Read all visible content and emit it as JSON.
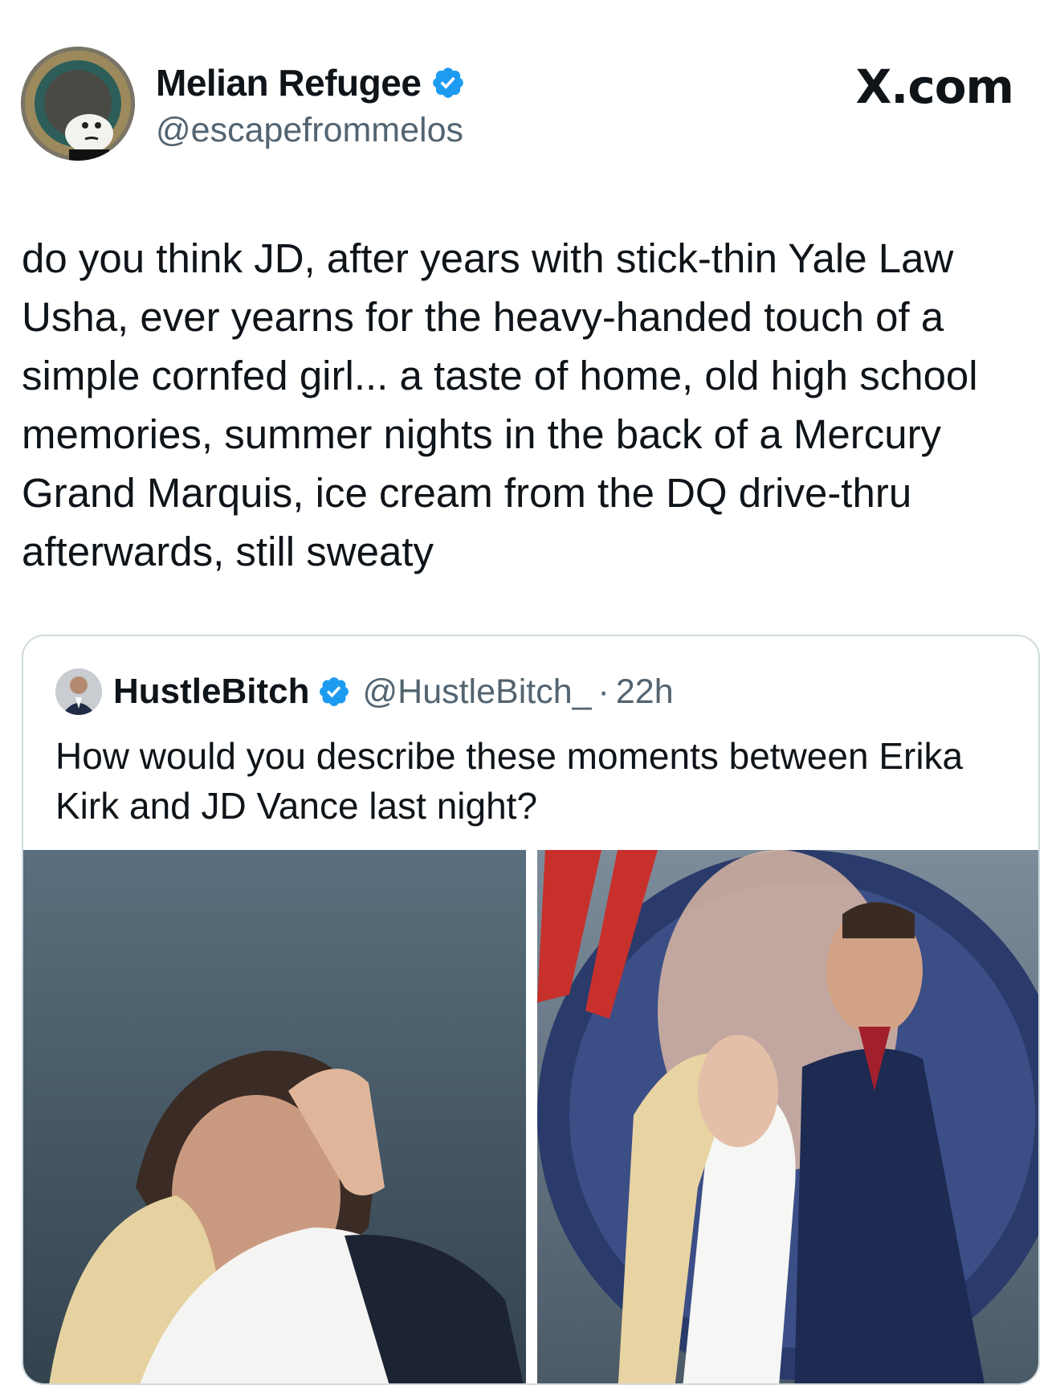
{
  "brand": {
    "site_label": "X.com"
  },
  "author": {
    "display_name": "Melian Refugee",
    "handle": "@escapefrommelos",
    "verified": true
  },
  "tweet": {
    "text": "do you think JD, after years with stick-thin Yale Law Usha, ever yearns for the heavy-handed touch of a simple cornfed girl... a taste of home, old high school memories, summer nights in the back of a Mercury Grand Marquis, ice cream from the DQ drive-thru afterwards, still sweaty"
  },
  "quoted_tweet": {
    "display_name": "HustleBitch",
    "handle": "@HustleBitch_",
    "separator": "·",
    "time": "22h",
    "verified": true,
    "text": "How would you describe these moments between Erika Kirk and JD Vance last night?",
    "media": [
      {
        "type": "photo",
        "icon": "photo"
      },
      {
        "type": "photo",
        "icon": "photo"
      }
    ]
  },
  "colors": {
    "verified_blue": "#1d9bf0",
    "text_primary": "#0f1419",
    "text_secondary": "#536471",
    "border": "#cfd9de"
  }
}
